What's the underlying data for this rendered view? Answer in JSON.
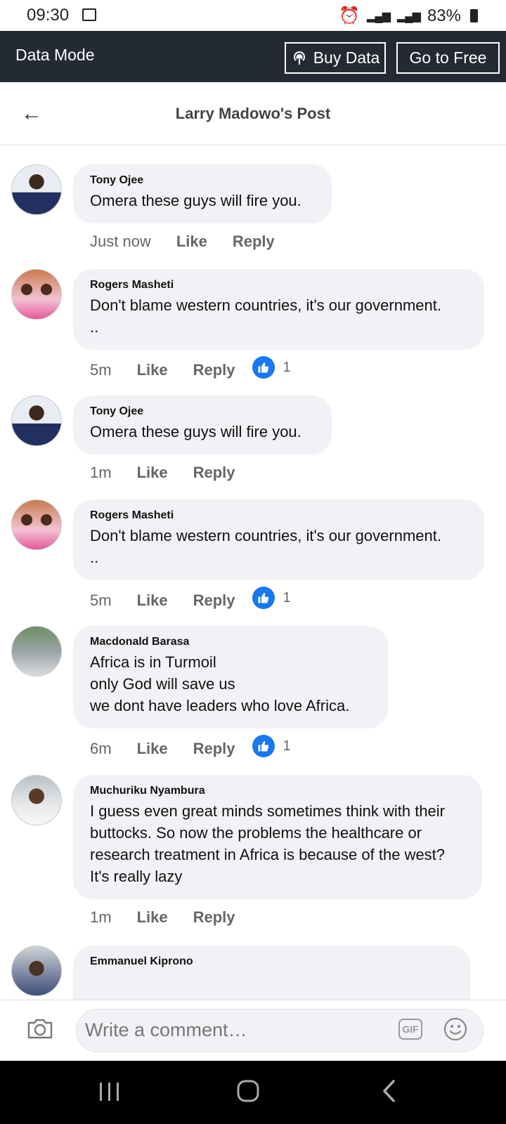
{
  "status_bar": {
    "time": "09:30",
    "battery": "83%"
  },
  "data_mode_bar": {
    "title": "Data Mode",
    "buy_data": "Buy Data",
    "go_to_free": "Go to Free"
  },
  "header": {
    "title": "Larry Madowo's Post"
  },
  "comments": [
    {
      "author": "Tony Ojee",
      "text": "Omera these guys will fire you.",
      "time": "Just now",
      "like": "Like",
      "reply": "Reply",
      "reactions": ""
    },
    {
      "author": "Rogers Masheti",
      "text": "Don't blame western countries, it's our government.\n..",
      "time": "5m",
      "like": "Like",
      "reply": "Reply",
      "reactions": "1"
    },
    {
      "author": "Tony Ojee",
      "text": "Omera these guys will fire you.",
      "time": "1m",
      "like": "Like",
      "reply": "Reply",
      "reactions": ""
    },
    {
      "author": "Rogers Masheti",
      "text": "Don't blame western countries, it's our government.\n..",
      "time": "5m",
      "like": "Like",
      "reply": "Reply",
      "reactions": "1"
    },
    {
      "author": "Macdonald Barasa",
      "text": "Africa is in Turmoil\nonly God will save us\nwe dont have leaders who love Africa.",
      "time": "6m",
      "like": "Like",
      "reply": "Reply",
      "reactions": "1"
    },
    {
      "author": "Muchuriku Nyambura",
      "text": "I guess even great minds sometimes think with their buttocks. So now the problems the healthcare or research treatment in Africa is because of the west? It's really lazy",
      "time": "1m",
      "like": "Like",
      "reply": "Reply",
      "reactions": ""
    },
    {
      "author": "Emmanuel Kiprono"
    }
  ],
  "composer": {
    "placeholder": "Write a comment…",
    "gif_label": "GIF"
  },
  "colors": {
    "accent": "#1877f2",
    "top_bar": "#242a33",
    "bubble": "#f0f2f5"
  }
}
